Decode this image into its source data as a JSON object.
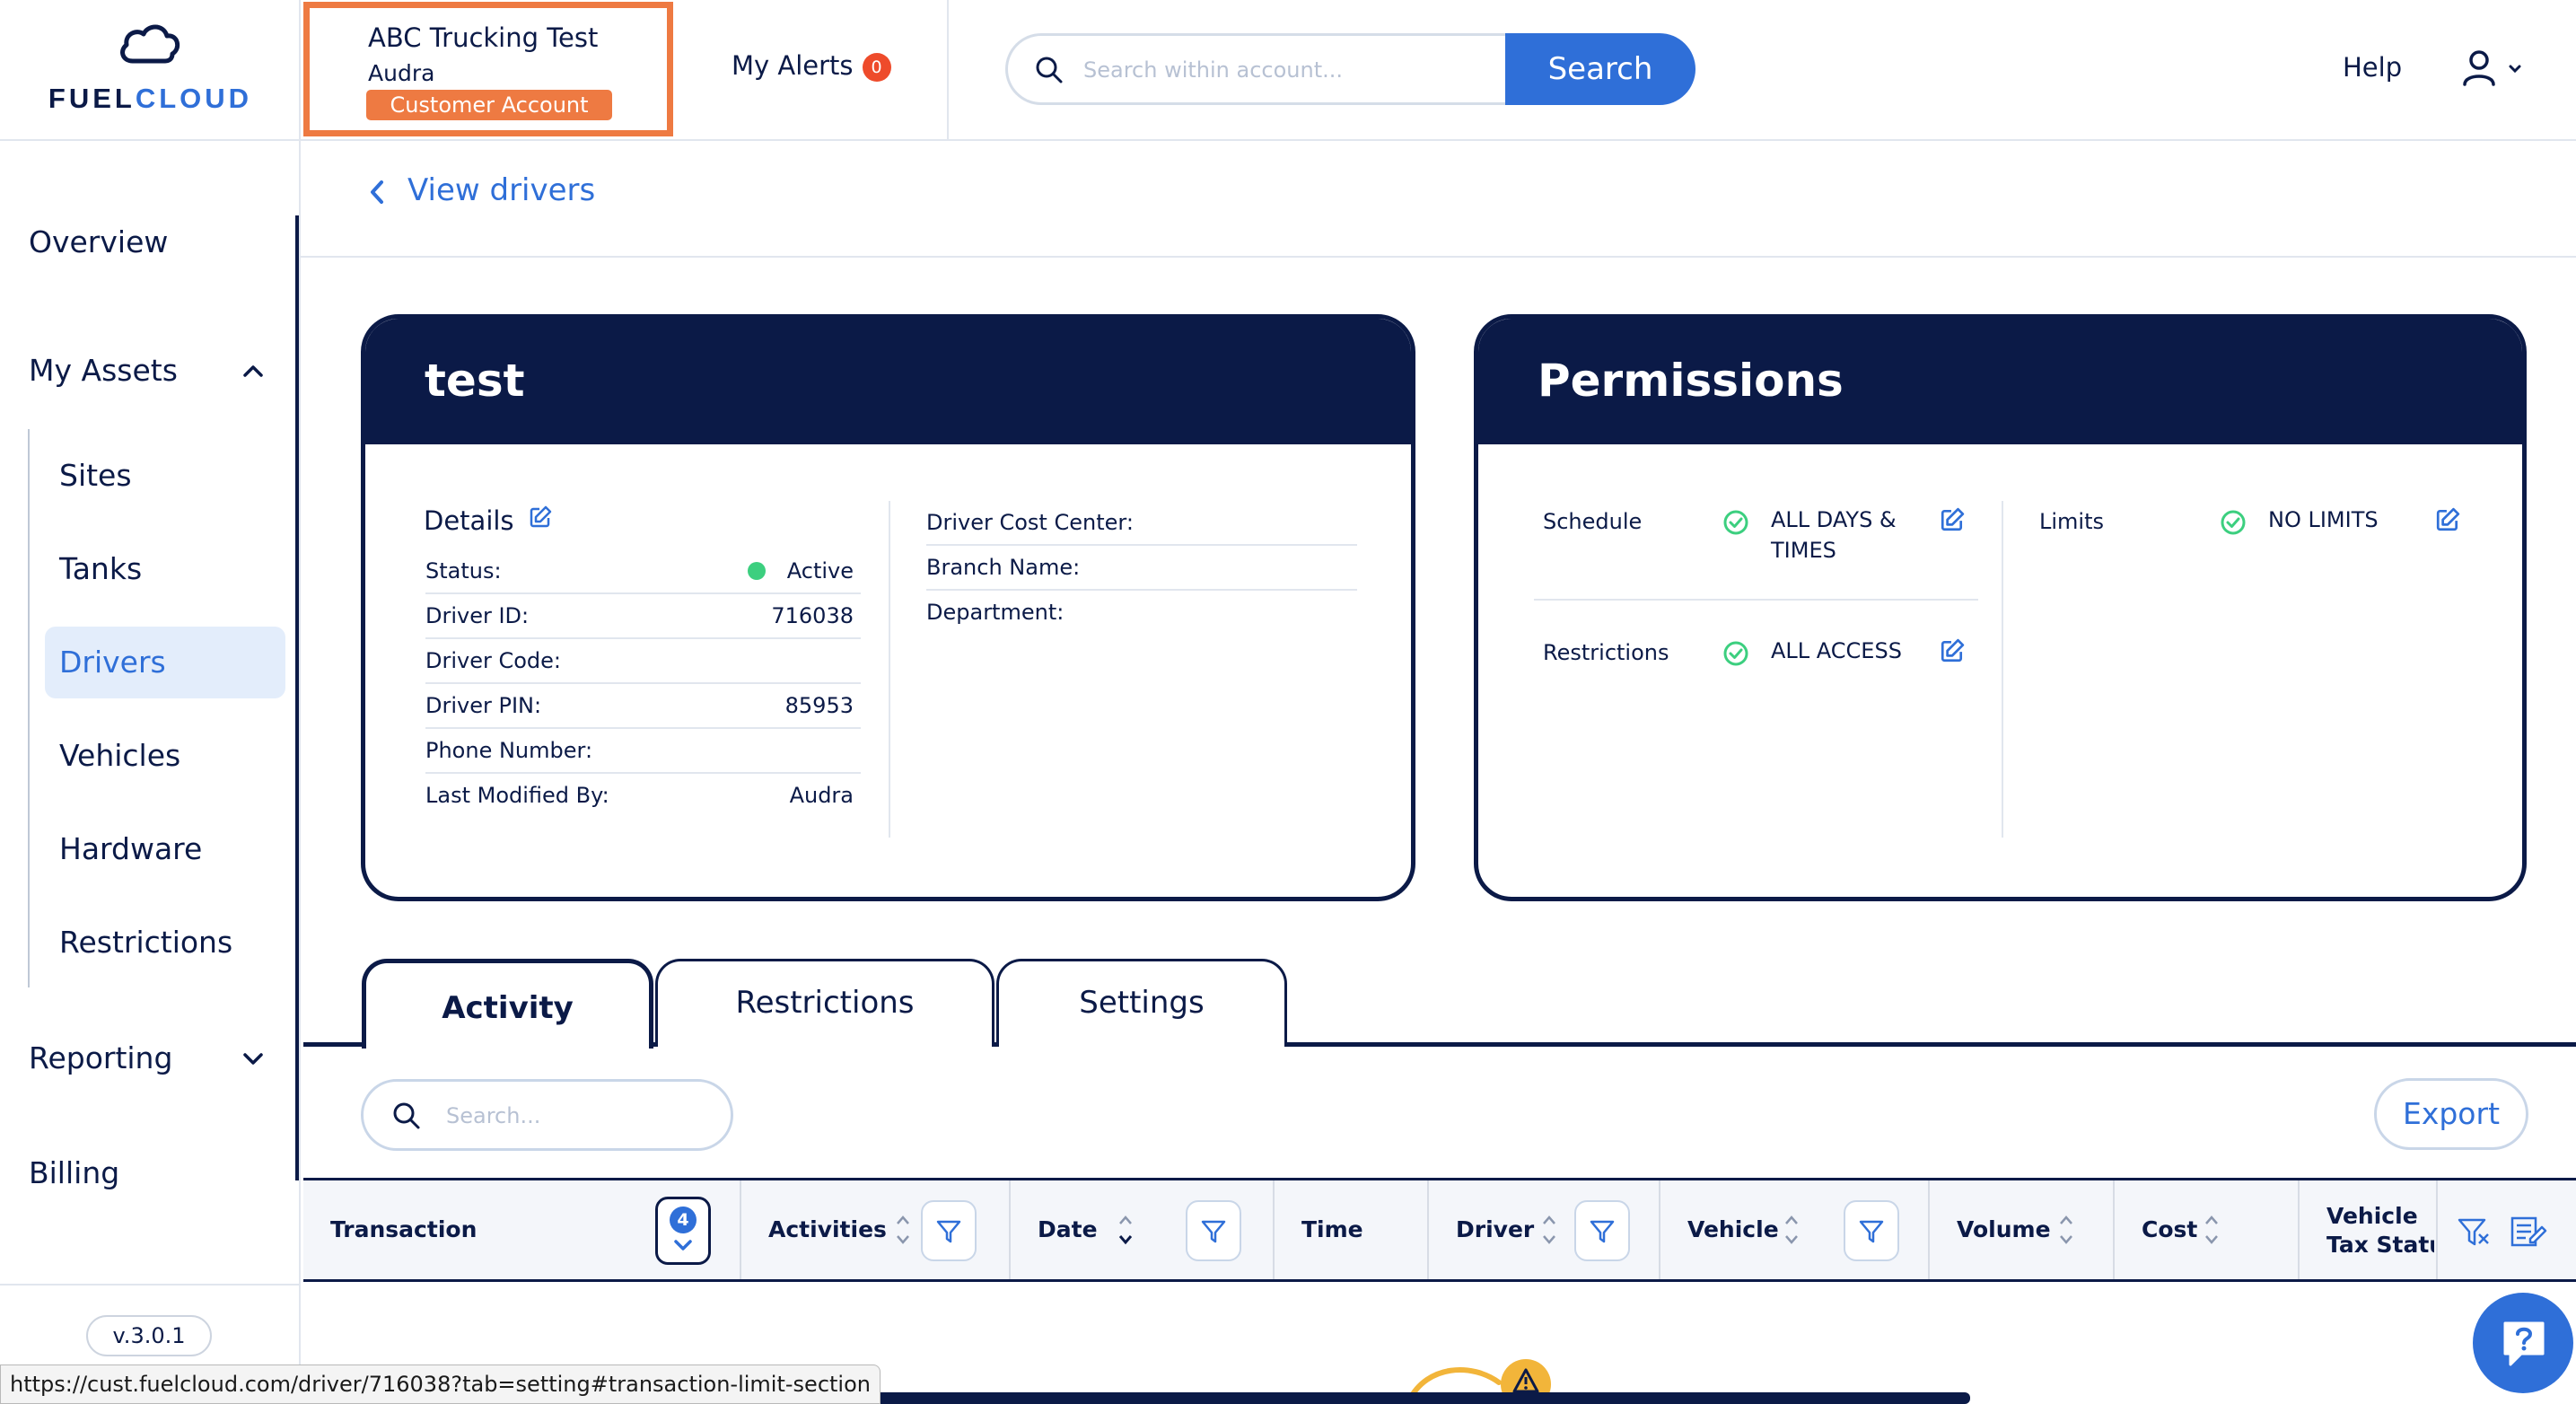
{
  "brand": {
    "logo_text_a": "FUEL",
    "logo_text_b": "CLOUD"
  },
  "account": {
    "name": "ABC Trucking Test",
    "user": "Audra",
    "badge": "Customer Account"
  },
  "alerts": {
    "label": "My Alerts",
    "count": "0"
  },
  "search": {
    "placeholder": "Search within account...",
    "button": "Search"
  },
  "header": {
    "help": "Help"
  },
  "sidebar": {
    "overview": "Overview",
    "my_assets": "My Assets",
    "assets": [
      "Sites",
      "Tanks",
      "Drivers",
      "Vehicles",
      "Hardware",
      "Restrictions"
    ],
    "active": "Drivers",
    "reporting": "Reporting",
    "billing": "Billing",
    "version": "v.3.0.1"
  },
  "back": {
    "label": "View drivers"
  },
  "driver_card": {
    "title": "test",
    "details_label": "Details",
    "status_label": "Status:",
    "status_value": "Active",
    "status_color": "#3ccf7f",
    "fields": [
      {
        "label": "Driver ID:",
        "value": "716038"
      },
      {
        "label": "Driver Code:",
        "value": ""
      },
      {
        "label": "Driver PIN:",
        "value": "85953"
      },
      {
        "label": "Phone Number:",
        "value": ""
      },
      {
        "label": "Last Modified By:",
        "value": "Audra"
      }
    ],
    "right_fields": [
      {
        "label": "Driver Cost Center:",
        "value": ""
      },
      {
        "label": "Branch Name:",
        "value": ""
      },
      {
        "label": "Department:",
        "value": ""
      }
    ]
  },
  "permissions": {
    "title": "Permissions",
    "schedule_label": "Schedule",
    "schedule_value_1": "ALL DAYS &",
    "schedule_value_2": "TIMES",
    "restrictions_label": "Restrictions",
    "restrictions_value": "ALL ACCESS",
    "limits_label": "Limits",
    "limits_value": "NO LIMITS"
  },
  "tabs": [
    "Activity",
    "Restrictions",
    "Settings"
  ],
  "active_tab": "Activity",
  "table": {
    "search_placeholder": "Search...",
    "export": "Export",
    "filter_count": "4",
    "columns": [
      "Transaction",
      "Activities",
      "Date",
      "Time",
      "Driver",
      "Vehicle",
      "Volume",
      "Cost",
      "Vehicle",
      "Tax Status"
    ]
  },
  "status_bar": {
    "url": "https://cust.fuelcloud.com/driver/716038?tab=setting#transaction-limit-section"
  },
  "colors": {
    "navy": "#0b1a47",
    "blue": "#2f6fd8",
    "orange": "#ee7a42",
    "alert_red": "#ee4b2b",
    "green": "#3ccf7f"
  }
}
